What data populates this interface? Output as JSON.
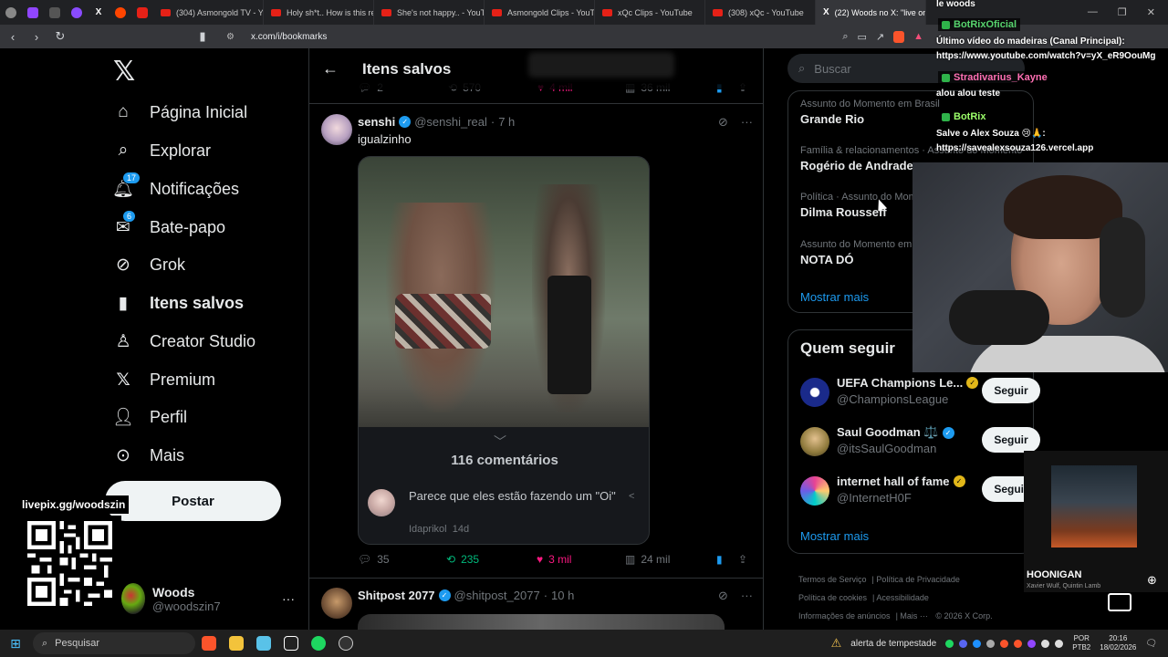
{
  "browser": {
    "tabs": [
      {
        "title": "(304) Asmongold TV - Yo",
        "icon": "youtube-icon"
      },
      {
        "title": "Holy sh*t.. How is this re",
        "icon": "youtube-icon"
      },
      {
        "title": "She's not happy.. - YouTu",
        "icon": "youtube-icon"
      },
      {
        "title": "Asmongold Clips - YouTu",
        "icon": "youtube-icon"
      },
      {
        "title": "xQc Clips - YouTube",
        "icon": "youtube-icon"
      },
      {
        "title": "(308) xQc - YouTube",
        "icon": "youtube-icon"
      },
      {
        "title": "(22) Woods no X: \"live on",
        "icon": "x-icon",
        "active": true
      }
    ],
    "url": "x.com/i/bookmarks"
  },
  "sidebar": {
    "nav": [
      {
        "label": "Página Inicial",
        "icon": "home-icon"
      },
      {
        "label": "Explorar",
        "icon": "search-icon"
      },
      {
        "label": "Notificações",
        "icon": "bell-icon",
        "badge": "17"
      },
      {
        "label": "Bate-papo",
        "icon": "mail-icon",
        "badge": "6"
      },
      {
        "label": "Grok",
        "icon": "grok-icon"
      },
      {
        "label": "Itens salvos",
        "icon": "bookmark-icon",
        "active": true
      },
      {
        "label": "Creator Studio",
        "icon": "creator-icon"
      },
      {
        "label": "Premium",
        "icon": "x-icon"
      },
      {
        "label": "Perfil",
        "icon": "person-icon"
      },
      {
        "label": "Mais",
        "icon": "more-icon"
      }
    ],
    "post_label": "Postar",
    "account": {
      "name": "Woods",
      "handle": "@woodszin7"
    }
  },
  "overlay_qr": {
    "label": "livepix.gg/woodszin"
  },
  "feed": {
    "title": "Itens salvos",
    "prev_tweet": {
      "replies": "2",
      "retweets": "570",
      "likes": "4 mil",
      "views": "36 mil"
    },
    "tweet": {
      "name": "senshi",
      "handle": "@senshi_real",
      "time": "7 h",
      "text": "igualzinho",
      "comments_label": "116 comentários",
      "top_comment": {
        "text": "Parece que eles estão fazendo um \"Oi\"",
        "author": "Idaprikol",
        "time": "14d"
      },
      "replies": "35",
      "retweets": "235",
      "likes": "3 mil",
      "views": "24 mil"
    },
    "next_tweet": {
      "name": "Shitpost 2077",
      "handle": "@shitpost_2077",
      "time": "10 h"
    }
  },
  "right": {
    "search_placeholder": "Buscar",
    "trends": [
      {
        "category": "Assunto do Momento em Brasil",
        "name": "Grande Rio"
      },
      {
        "category": "Família & relacionamentos · Assunto do Momento",
        "name": "Rogério de Andrade"
      },
      {
        "category": "Política · Assunto do Momento",
        "name": "Dilma Rousseff"
      },
      {
        "category": "Assunto do Momento em Brasil",
        "name": "NOTA DÓ"
      }
    ],
    "show_more": "Mostrar mais",
    "who_to_follow_title": "Quem seguir",
    "who_to_follow": [
      {
        "name": "UEFA Champions Le...",
        "handle": "@ChampionsLeague",
        "badge": "gold",
        "button": "Seguir"
      },
      {
        "name": "Saul Goodman ⚖️",
        "handle": "@itsSaulGoodman",
        "badge": "blue",
        "button": "Seguir"
      },
      {
        "name": "internet hall of fame",
        "handle": "@InternetH0F",
        "badge": "gold",
        "button": "Seguir"
      }
    ],
    "footer": [
      "Termos de Serviço",
      "Política de Privacidade",
      "Política de cookies",
      "Acessibilidade",
      "Informações de anúncios",
      "Mais ···",
      "© 2026 X Corp."
    ]
  },
  "chat": {
    "header": "le woods",
    "messages": [
      {
        "user": "BotRixOficial",
        "text": "Último vídeo do madeiras (Canal Principal): https://www.youtube.com/watch?v=yX_eR9OouMg"
      },
      {
        "user": "Stradivarius_Kayne",
        "text": "alou alou teste"
      },
      {
        "user": "BotRix",
        "text": "Salve o Alex Souza 😢🙏: https://savealexsouza126.vercel.app"
      }
    ]
  },
  "music": {
    "track": "HOONIGAN",
    "artist": "Xavier Wulf, Quintin Lamb"
  },
  "taskbar": {
    "search_placeholder": "Pesquisar",
    "weather": "alerta de tempestade",
    "lang": [
      "POR",
      "PTB2"
    ],
    "time": "20:16",
    "date": "18/02/2026"
  },
  "colors": {
    "accent": "#1d9bf0",
    "like": "#f91880",
    "retweet": "#00ba7c",
    "background": "#000000"
  }
}
